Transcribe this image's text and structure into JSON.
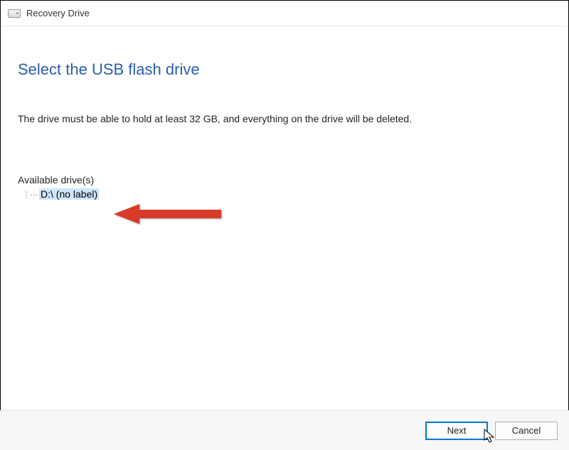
{
  "window": {
    "title": "Recovery Drive"
  },
  "main": {
    "heading": "Select the USB flash drive",
    "description": "The drive must be able to hold at least 32 GB, and everything on the drive will be deleted.",
    "available_label": "Available drive(s)",
    "drives": [
      {
        "label": "D:\\ (no label)"
      }
    ]
  },
  "footer": {
    "next_label": "Next",
    "cancel_label": "Cancel"
  }
}
